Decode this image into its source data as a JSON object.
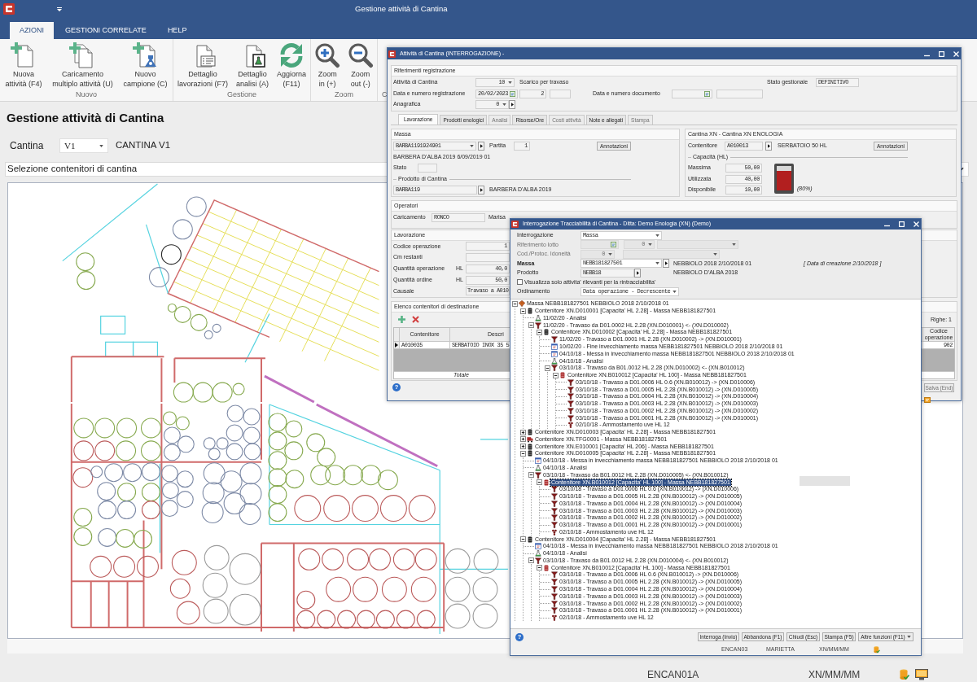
{
  "window": {
    "title": "Gestione attività di Cantina"
  },
  "ribbon": {
    "tabs": [
      {
        "label": "AZIONI",
        "selected": true
      },
      {
        "label": "GESTIONI CORRELATE",
        "selected": false
      },
      {
        "label": "HELP",
        "selected": false
      }
    ],
    "groups": [
      {
        "label": "Nuovo",
        "buttons": [
          {
            "kind": "new",
            "lines": [
              "Nuova",
              "attività (F4)"
            ]
          },
          {
            "kind": "multi",
            "lines": [
              "Caricamento",
              "multiplo attività (U)"
            ]
          },
          {
            "kind": "sample",
            "lines": [
              "Nuovo",
              "campione (C)"
            ]
          }
        ]
      },
      {
        "label": "Gestione",
        "buttons": [
          {
            "kind": "list",
            "lines": [
              "Dettaglio",
              "lavorazioni (F7)"
            ]
          },
          {
            "kind": "analysis",
            "lines": [
              "Dettaglio",
              "analisi (A)"
            ]
          },
          {
            "kind": "refresh",
            "lines": [
              "Aggiorna",
              "(F11)"
            ]
          }
        ]
      },
      {
        "label": "Zoom",
        "buttons": [
          {
            "kind": "zoom-in",
            "lines": [
              "Zoom",
              "in (+)"
            ]
          },
          {
            "kind": "zoom-out",
            "lines": [
              "Zoom",
              "out (-)"
            ]
          }
        ]
      },
      {
        "label": "C"
      }
    ]
  },
  "page": {
    "heading": "Gestione attività di Cantina",
    "cantina": {
      "label": "Cantina",
      "value": "V1",
      "description": "CANTINA V1"
    },
    "selection_bar": {
      "label": "Selezione contenitori di cantina"
    }
  },
  "status_bar": {
    "items": [
      "ENCAN01A",
      "XN/MM/MM"
    ]
  },
  "activity_dialog": {
    "title": "Attività di Cantina (INTERROGAZIONE) -",
    "references": {
      "title": "Riferimenti registrazione",
      "activity_label": "Attività di Cantina",
      "activity_code": "10",
      "activity_name": "Scarico per travaso",
      "status_label": "Stato gestionale",
      "status_value": "DEFINITIVO",
      "registration_label": "Data e numero registrazione",
      "registration_date": "20/02/2023",
      "registration_number": "2",
      "document_label": "Data e numero documento",
      "registry_label": "Anagrafica",
      "registry_code": "0"
    },
    "tabs": [
      {
        "label": "Lavorazione",
        "selected": true,
        "disabled": false
      },
      {
        "label": "Prodotti enologici",
        "selected": false,
        "disabled": false
      },
      {
        "label": "Analisi",
        "selected": false,
        "disabled": true
      },
      {
        "label": "Risorse/Ore",
        "selected": false,
        "disabled": false
      },
      {
        "label": "Costi attività",
        "selected": false,
        "disabled": true
      },
      {
        "label": "Note e allegati",
        "selected": false,
        "disabled": false
      },
      {
        "label": "Stampa",
        "selected": false,
        "disabled": true
      }
    ],
    "mass": {
      "title": "Massa",
      "code": "BARBA1191924901",
      "lot_label": "Partita",
      "lot": "1",
      "notes_button": "Annotazioni",
      "description": "BARBERA D'ALBA 2019 6/09/2019 01",
      "state_label": "Stato",
      "product_title": "Prodotto di Cantina",
      "product_code": "BARBA119",
      "product_name": "BARBERA D'ALBA 2019"
    },
    "cellar": {
      "title": "Cantina XN - Cantina XN ENOLOGIA",
      "container_label": "Contenitore",
      "container_code": "A010013",
      "container_name": "SERBATOIO 50 HL",
      "notes_button": "Annotazioni",
      "capacity_title": "Capacità (HL)",
      "capacity": [
        {
          "label": "Massima",
          "value": "50,00"
        },
        {
          "label": "Utilizzata",
          "value": "40,00"
        },
        {
          "label": "Disponibile",
          "value": "10,00"
        }
      ],
      "tank": {
        "level": 0.8,
        "reading": "(80%)"
      }
    },
    "operators": {
      "title": "Operatori",
      "loading_label": "Caricamento",
      "loading_code": "RONCO",
      "loading_name": "Marisa"
    },
    "processing": {
      "title": "Lavorazione",
      "rows": [
        {
          "kind": "number",
          "label": "Codice operazione",
          "value": "1"
        },
        {
          "kind": "number",
          "label": "Cm restanti"
        },
        {
          "kind": "number",
          "label": "Quantità operazione",
          "unit": "HL",
          "value": "40,0"
        },
        {
          "kind": "number",
          "label": "Quantità ordine",
          "unit": "HL",
          "value": "50,0"
        },
        {
          "kind": "text",
          "label": "Causale",
          "value": "Travaso a A010"
        }
      ]
    },
    "destinations": {
      "title": "Elenco contenitori di destinazione",
      "row_count": "Righe: 1",
      "columns": [
        "Contenitore",
        "Descri",
        "Codice operazione"
      ],
      "rows": [
        {
          "selected": true,
          "cells": [
            "A010035",
            "SERBATOIO INOX 35 5",
            "902"
          ]
        }
      ],
      "total_label": "Totale"
    },
    "help": "?",
    "save_button": {
      "label": "Salva (End)",
      "disabled": true
    }
  },
  "trace_dialog": {
    "title": "Interrogazione Tracciabilità di Cantina - Ditta: Demo Enologia (XN) (Demo)",
    "query": {
      "label": "Interrogazione",
      "value": "Massa"
    },
    "lot": {
      "label": "Riferimento lotto",
      "number": "0",
      "disabled": true
    },
    "protocol": {
      "label": "Cod./Protoc. Idoneità",
      "number": "0",
      "disabled": true
    },
    "mass": {
      "label": "Massa",
      "code": "NEBB181827501",
      "description": "NEBBIOLO 2018 2/10/2018 01",
      "created": "[ Data di creazione 2/10/2018 ]"
    },
    "product": {
      "label": "Prodotto",
      "code": "NEBB18",
      "name": "NEBBIOLO D'ALBA 2018"
    },
    "filter": {
      "label": "Visualizza solo attivita' rilevanti per la rintracciabilita'",
      "checked": false
    },
    "ordering": {
      "label": "Ordinamento",
      "value": "Data operazione - Decrescente"
    },
    "tree": [
      {
        "kind": "mass",
        "text": "Massa NEBB181827501 NEBBIOLO 2018 2/10/2018 01",
        "expanded": true,
        "selected": false,
        "children": [
          {
            "kind": "tank",
            "text": "Contenitore XN.D010001 [Capacita' HL 2.28] - Massa NEBB181827501",
            "expanded": true,
            "selected": false,
            "children": [
              {
                "kind": "analysis",
                "text": "11/02/20 - Analisi",
                "selected": false
              },
              {
                "kind": "transfer",
                "text": "11/02/20 - Travaso da D01.0002 HL 2.28 (XN.D010001) <- (XN.D010002)",
                "expanded": true,
                "selected": false,
                "children": [
                  {
                    "kind": "tank",
                    "text": "Contenitore XN.D010002 [Capacita' HL 2.28] - Massa NEBB181827501",
                    "expanded": true,
                    "selected": false,
                    "children": [
                      {
                        "kind": "transfer",
                        "text": "11/02/20 - Travaso a D01.0001 HL 2.28 (XN.D010002) -> (XN.D010001)",
                        "selected": false
                      },
                      {
                        "kind": "aging",
                        "text": "10/02/20 - Fine invecchiamento massa NEBB181827501 NEBBIOLO 2018 2/10/2018 01",
                        "selected": false
                      },
                      {
                        "kind": "aging",
                        "text": "04/10/18 - Messa in invecchiamento massa NEBB181827501 NEBBIOLO 2018 2/10/2018 01",
                        "selected": false
                      },
                      {
                        "kind": "analysis",
                        "text": "04/10/18 - Analisi",
                        "selected": false
                      },
                      {
                        "kind": "transfer",
                        "text": "03/10/18 - Travaso da B01.0012 HL 2.28 (XN.D010002) <- (XN.B010012)",
                        "expanded": true,
                        "selected": false,
                        "children": [
                          {
                            "kind": "barrel",
                            "text": "Contenitore XN.B010012 [Capacita' HL 100] - Massa NEBB181827501",
                            "expanded": true,
                            "selected": false,
                            "children": [
                              {
                                "kind": "transfer",
                                "text": "03/10/18 - Travaso a D01.0006 HL 0.6 (XN.B010012) -> (XN.D010006)",
                                "selected": false
                              },
                              {
                                "kind": "transfer",
                                "text": "03/10/18 - Travaso a D01.0005 HL 2.28 (XN.B010012) -> (XN.D010005)",
                                "selected": false
                              },
                              {
                                "kind": "transfer",
                                "text": "03/10/18 - Travaso a D01.0004 HL 2.28 (XN.B010012) -> (XN.D010004)",
                                "selected": false
                              },
                              {
                                "kind": "transfer",
                                "text": "03/10/18 - Travaso a D01.0003 HL 2.28 (XN.B010012) -> (XN.D010003)",
                                "selected": false
                              },
                              {
                                "kind": "transfer",
                                "text": "03/10/18 - Travaso a D01.0002 HL 2.28 (XN.B010012) -> (XN.D010002)",
                                "selected": false
                              },
                              {
                                "kind": "transfer",
                                "text": "03/10/18 - Travaso a D01.0001 HL 2.28 (XN.B010012) -> (XN.D010001)",
                                "selected": false
                              },
                              {
                                "kind": "crushing",
                                "text": "02/10/18 - Ammostamento uve HL 12",
                                "selected": false
                              }
                            ]
                          }
                        ]
                      }
                    ]
                  }
                ]
              }
            ]
          },
          {
            "kind": "tank",
            "text": "Contenitore XN.D010003 [Capacita' HL 2.28] - Massa NEBB181827501",
            "expanded": false,
            "selected": false
          },
          {
            "kind": "truck",
            "text": "Contenitore XN.TFG0001 - Massa NEBB181827501",
            "expanded": false,
            "selected": false
          },
          {
            "kind": "tank",
            "text": "Contenitore XN.E010001 [Capacita' HL 206] - Massa NEBB181827501",
            "expanded": false,
            "selected": false
          },
          {
            "kind": "tank",
            "text": "Contenitore XN.D010005 [Capacita' HL 2.28] - Massa NEBB181827501",
            "expanded": true,
            "selected": false,
            "children": [
              {
                "kind": "aging",
                "text": "04/10/18 - Messa in invecchiamento massa NEBB181827501 NEBBIOLO 2018 2/10/2018 01",
                "selected": false
              },
              {
                "kind": "analysis",
                "text": "04/10/18 - Analisi",
                "selected": false
              },
              {
                "kind": "transfer",
                "text": "03/10/18 - Travaso da B01.0012 HL 2.28 (XN.D010005) <- (XN.B010012)",
                "expanded": true,
                "selected": false,
                "children": [
                  {
                    "kind": "barrel",
                    "text": "Contenitore XN.B010012 [Capacita' HL 100] - Massa NEBB181827501",
                    "expanded": true,
                    "selected": true,
                    "children": [
                      {
                        "kind": "transfer",
                        "text": "03/10/18 - Travaso a D01.0006 HL 0.6 (XN.B010012) -> (XN.D010006)",
                        "selected": false
                      },
                      {
                        "kind": "transfer",
                        "text": "03/10/18 - Travaso a D01.0005 HL 2.28 (XN.B010012) -> (XN.D010005)",
                        "selected": false
                      },
                      {
                        "kind": "transfer",
                        "text": "03/10/18 - Travaso a D01.0004 HL 2.28 (XN.B010012) -> (XN.D010004)",
                        "selected": false
                      },
                      {
                        "kind": "transfer",
                        "text": "03/10/18 - Travaso a D01.0003 HL 2.28 (XN.B010012) -> (XN.D010003)",
                        "selected": false
                      },
                      {
                        "kind": "transfer",
                        "text": "03/10/18 - Travaso a D01.0002 HL 2.28 (XN.B010012) -> (XN.D010002)",
                        "selected": false
                      },
                      {
                        "kind": "transfer",
                        "text": "03/10/18 - Travaso a D01.0001 HL 2.28 (XN.B010012) -> (XN.D010001)",
                        "selected": false
                      },
                      {
                        "kind": "crushing",
                        "text": "02/10/18 - Ammostamento uve HL 12",
                        "selected": false
                      }
                    ]
                  }
                ]
              }
            ]
          },
          {
            "kind": "tank",
            "text": "Contenitore XN.D010004 [Capacita' HL 2.28] - Massa NEBB181827501",
            "expanded": true,
            "selected": false,
            "children": [
              {
                "kind": "aging",
                "text": "04/10/18 - Messa in invecchiamento massa NEBB181827501 NEBBIOLO 2018 2/10/2018 01",
                "selected": false
              },
              {
                "kind": "analysis",
                "text": "04/10/18 - Analisi",
                "selected": false
              },
              {
                "kind": "transfer",
                "text": "03/10/18 - Travaso da B01.0012 HL 2.28 (XN.D010004) <- (XN.B010012)",
                "expanded": true,
                "selected": false,
                "children": [
                  {
                    "kind": "barrel",
                    "text": "Contenitore XN.B010012 [Capacita' HL 100] - Massa NEBB181827501",
                    "expanded": true,
                    "selected": false,
                    "children": [
                      {
                        "kind": "transfer",
                        "text": "03/10/18 - Travaso a D01.0006 HL 0.6 (XN.B010012) -> (XN.D010006)",
                        "selected": false
                      },
                      {
                        "kind": "transfer",
                        "text": "03/10/18 - Travaso a D01.0005 HL 2.28 (XN.B010012) -> (XN.D010005)",
                        "selected": false
                      },
                      {
                        "kind": "transfer",
                        "text": "03/10/18 - Travaso a D01.0004 HL 2.28 (XN.B010012) -> (XN.D010004)",
                        "selected": false
                      },
                      {
                        "kind": "transfer",
                        "text": "03/10/18 - Travaso a D01.0003 HL 2.28 (XN.B010012) -> (XN.D010003)",
                        "selected": false
                      },
                      {
                        "kind": "transfer",
                        "text": "03/10/18 - Travaso a D01.0002 HL 2.28 (XN.B010012) -> (XN.D010002)",
                        "selected": false
                      },
                      {
                        "kind": "transfer",
                        "text": "03/10/18 - Travaso a D01.0001 HL 2.28 (XN.B010012) -> (XN.D010001)",
                        "selected": false
                      },
                      {
                        "kind": "crushing",
                        "text": "02/10/18 - Ammostamento uve HL 12",
                        "selected": false
                      }
                    ]
                  }
                ]
              }
            ]
          }
        ]
      }
    ],
    "help": "?",
    "buttons": [
      {
        "kind": "plain",
        "label": "Interroga (Invio)"
      },
      {
        "kind": "plain",
        "label": "Abbandona (F1)"
      },
      {
        "kind": "plain",
        "label": "Chiudi (Esc)"
      },
      {
        "kind": "plain",
        "label": "Stampa (F5)"
      },
      {
        "kind": "menu",
        "label": "Altre funzioni (F11)"
      }
    ],
    "status": [
      "ENCAN03",
      "MARIETTA",
      "XN/MM/MM"
    ]
  }
}
